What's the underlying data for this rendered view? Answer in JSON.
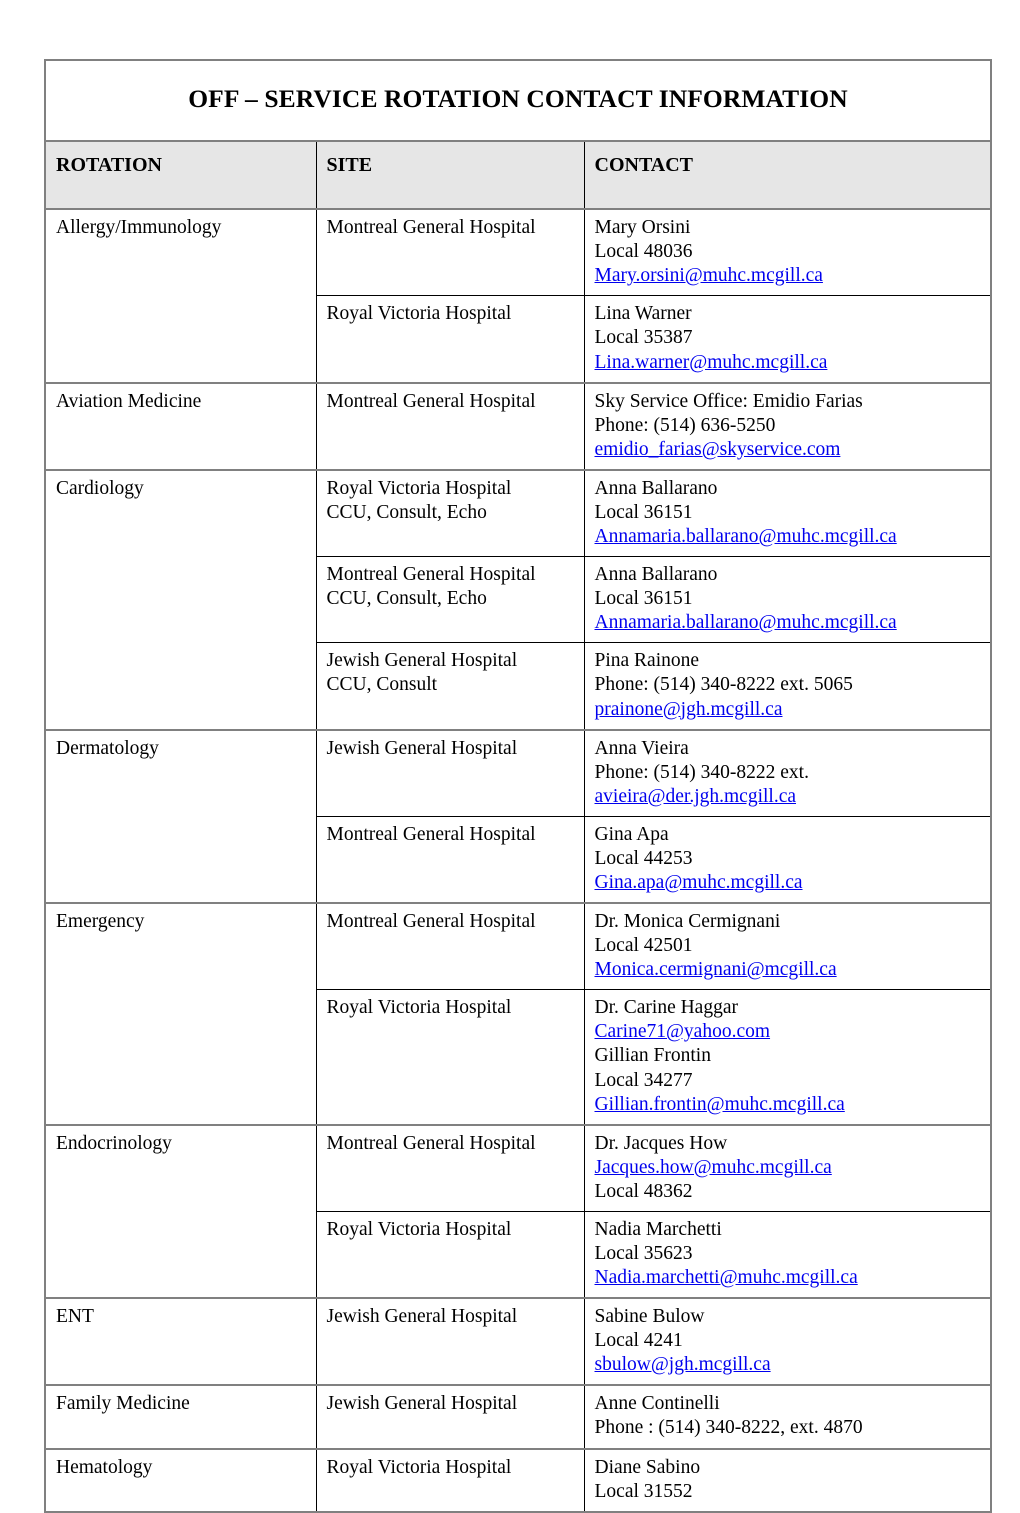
{
  "document": {
    "title": "OFF – SERVICE ROTATION CONTACT INFORMATION"
  },
  "table": {
    "columns": {
      "rotation": "ROTATION",
      "site": "SITE",
      "contact": "CONTACT"
    },
    "rows": [
      {
        "rotation": "Allergy/Immunology",
        "entries": [
          {
            "site": "Montreal General Hospital",
            "contact_lines": [
              "Mary Orsini",
              "Local 48036"
            ],
            "email": "Mary.orsini@muhc.mcgill.ca"
          },
          {
            "site": "Royal Victoria Hospital",
            "contact_lines": [
              "Lina Warner",
              "Local 35387"
            ],
            "email": "Lina.warner@muhc.mcgill.ca"
          }
        ]
      },
      {
        "rotation": "Aviation Medicine",
        "entries": [
          {
            "site": "Montreal General Hospital",
            "contact_lines": [
              "Sky Service Office: Emidio Farias",
              "Phone: (514) 636-5250"
            ],
            "email": "emidio_farias@skyservice.com"
          }
        ]
      },
      {
        "rotation": "Cardiology",
        "entries": [
          {
            "site": "Royal Victoria Hospital\nCCU, Consult, Echo",
            "contact_lines": [
              "Anna Ballarano",
              "Local 36151"
            ],
            "email": "Annamaria.ballarano@muhc.mcgill.ca"
          },
          {
            "site": "Montreal General Hospital\nCCU, Consult, Echo",
            "contact_lines": [
              "Anna Ballarano",
              "Local 36151"
            ],
            "email": "Annamaria.ballarano@muhc.mcgill.ca"
          },
          {
            "site": "Jewish General Hospital\nCCU, Consult",
            "contact_lines": [
              "Pina Rainone",
              "Phone: (514) 340-8222 ext. 5065"
            ],
            "email": "prainone@jgh.mcgill.ca"
          }
        ]
      },
      {
        "rotation": "Dermatology",
        "entries": [
          {
            "site": "Jewish General Hospital",
            "contact_lines": [
              "Anna Vieira",
              "Phone: (514) 340-8222 ext."
            ],
            "email": "avieira@der.jgh.mcgill.ca"
          },
          {
            "site": "Montreal General Hospital",
            "contact_lines": [
              "Gina Apa",
              "Local 44253"
            ],
            "email": "Gina.apa@muhc.mcgill.ca"
          }
        ]
      },
      {
        "rotation": "Emergency",
        "entries": [
          {
            "site": "Montreal General Hospital",
            "contact_lines": [
              "Dr. Monica Cermignani",
              "Local 42501"
            ],
            "email": "Monica.cermignani@mcgill.ca"
          },
          {
            "site": "Royal Victoria Hospital",
            "contact_lines": [
              "Dr. Carine Haggar"
            ],
            "email": "Carine71@yahoo.com",
            "contact_lines_after": [
              "Gillian Frontin",
              "Local 34277"
            ],
            "email_after": "Gillian.frontin@muhc.mcgill.ca"
          }
        ]
      },
      {
        "rotation": "Endocrinology",
        "entries": [
          {
            "site": "Montreal General Hospital",
            "contact_lines": [
              "Dr. Jacques How"
            ],
            "email": "Jacques.how@muhc.mcgill.ca",
            "contact_lines_after": [
              "Local 48362"
            ]
          },
          {
            "site": "Royal Victoria Hospital",
            "contact_lines": [
              "Nadia Marchetti",
              "Local 35623"
            ],
            "email": "Nadia.marchetti@muhc.mcgill.ca"
          }
        ]
      },
      {
        "rotation": "ENT",
        "entries": [
          {
            "site": "Jewish General Hospital",
            "contact_lines": [
              "Sabine Bulow",
              "Local 4241"
            ],
            "email": "sbulow@jgh.mcgill.ca"
          }
        ]
      },
      {
        "rotation": "Family Medicine",
        "entries": [
          {
            "site": "Jewish General Hospital",
            "contact_lines": [
              "Anne Continelli",
              "Phone : (514) 340-8222, ext. 4870"
            ],
            "email": ""
          }
        ]
      },
      {
        "rotation": "Hematology",
        "entries": [
          {
            "site": "Royal Victoria Hospital",
            "contact_lines": [
              "Diane Sabino",
              "Local 31552"
            ],
            "email": ""
          }
        ]
      }
    ]
  },
  "colors": {
    "header_shading": "#e6e6e6",
    "link": "#0000ee",
    "outer_border": "#808080",
    "inner_border": "#000000"
  }
}
